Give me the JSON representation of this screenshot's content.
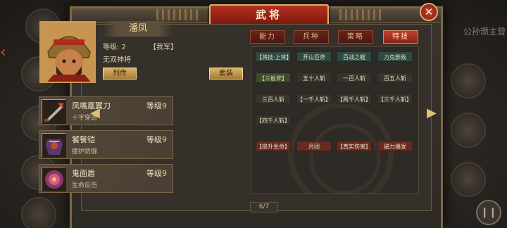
{
  "window": {
    "title": "武将"
  },
  "background": {
    "right_label": "公孙瓒主营"
  },
  "hero": {
    "name": "潘凤",
    "level_label": "等级:",
    "level_value": "2",
    "faction": "【我军】",
    "title": "无双神将",
    "buttons": {
      "biography": "列传",
      "outfit": "套装"
    }
  },
  "equipment": [
    {
      "name": "凤嘴凰翼刀",
      "level_label": "等级",
      "level": "9",
      "desc": "十字穿透",
      "icon": "blade-icon"
    },
    {
      "name": "饕餮铠",
      "level_label": "等级",
      "level": "9",
      "desc": "援护防御",
      "icon": "armor-icon"
    },
    {
      "name": "鬼面盾",
      "level_label": "等级",
      "level": "9",
      "desc": "生命反伤",
      "icon": "shield-icon"
    }
  ],
  "tabs": [
    {
      "label": "能力",
      "active": false
    },
    {
      "label": "兵种",
      "active": false
    },
    {
      "label": "策略",
      "active": false
    },
    {
      "label": "特技",
      "active": true
    }
  ],
  "skills": [
    {
      "label": "【将技·上将】",
      "style": "teal"
    },
    {
      "label": "开山巨斧",
      "style": "teal"
    },
    {
      "label": "百战之躯",
      "style": "teal"
    },
    {
      "label": "力克群敌",
      "style": "teal"
    },
    {
      "label": "【三板斧】",
      "style": "green"
    },
    {
      "label": "五十人斩",
      "style": "plain"
    },
    {
      "label": "一百人斩",
      "style": "plain"
    },
    {
      "label": "百五人斩",
      "style": "plain"
    },
    {
      "label": "三百人斩",
      "style": "plain"
    },
    {
      "label": "【一千人斩】",
      "style": "plain"
    },
    {
      "label": "【两千人斩】",
      "style": "plain"
    },
    {
      "label": "【三千人斩】",
      "style": "plain"
    },
    {
      "label": "【四千人斩】",
      "style": "plain"
    },
    {
      "label": "【提升生命】",
      "style": "red"
    },
    {
      "label": "月团",
      "style": "red"
    },
    {
      "label": "【真实伤害】",
      "style": "red"
    },
    {
      "label": "磁力爆发",
      "style": "red"
    }
  ],
  "pagination": {
    "text": "6/7"
  }
}
